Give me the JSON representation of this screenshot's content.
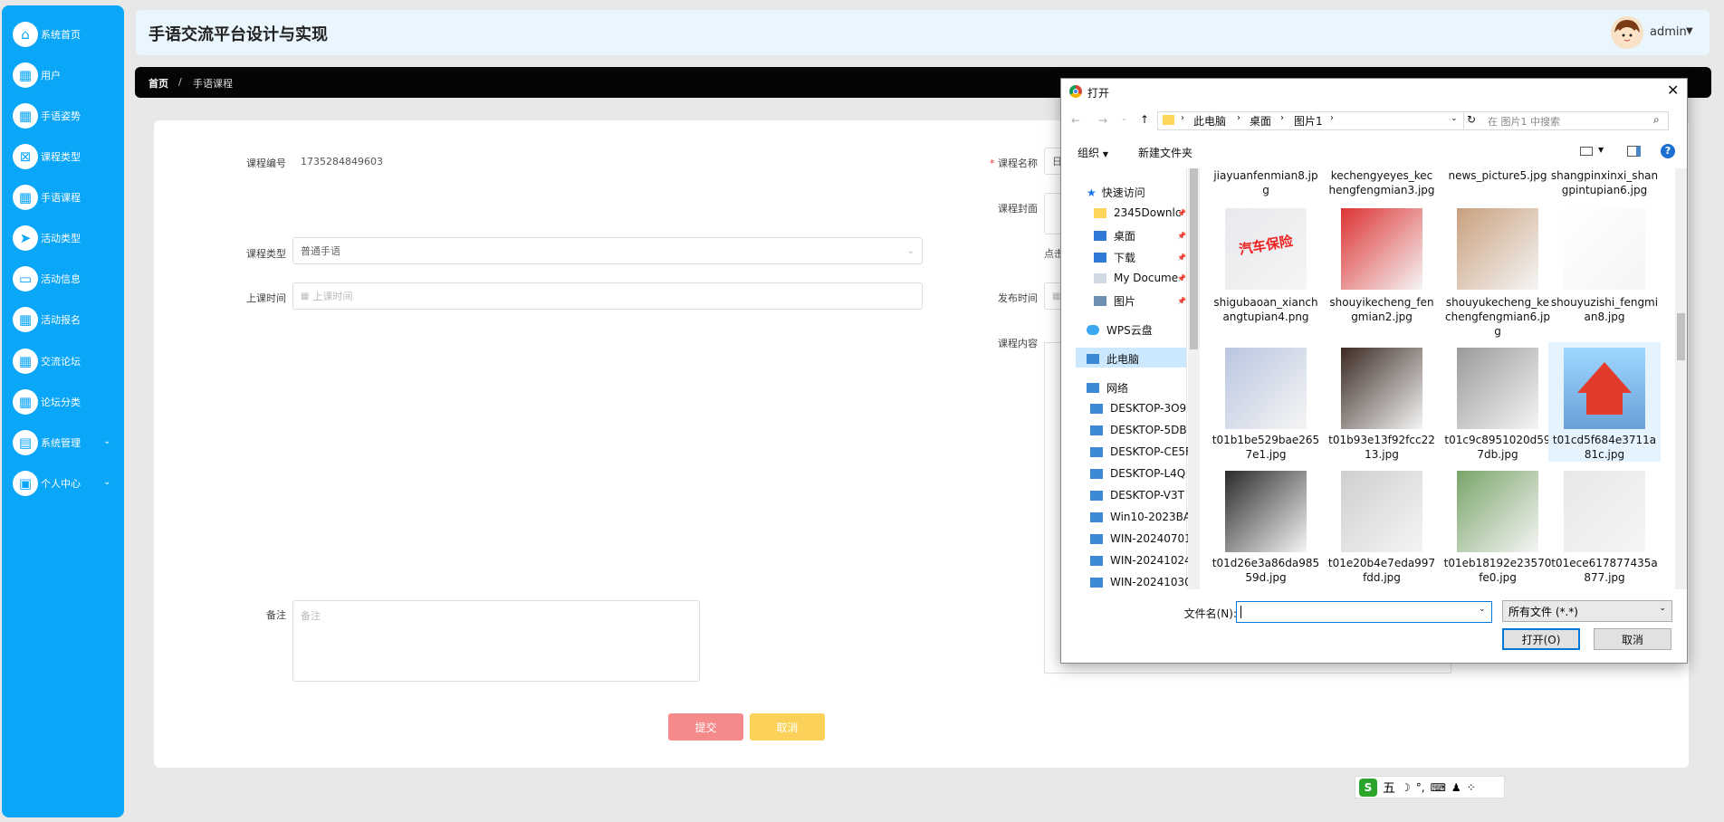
{
  "app": {
    "title": "手语交流平台设计与实现",
    "user": "admin"
  },
  "sidebar": {
    "items": [
      {
        "label": "系统首页",
        "icon": "home-icon",
        "glyph": "⌂"
      },
      {
        "label": "用户",
        "icon": "grid-icon",
        "glyph": "▦"
      },
      {
        "label": "手语姿势",
        "icon": "grid-icon",
        "glyph": "▦"
      },
      {
        "label": "课程类型",
        "icon": "document-icon",
        "glyph": "⊠"
      },
      {
        "label": "手语课程",
        "icon": "grid-icon",
        "glyph": "▦"
      },
      {
        "label": "活动类型",
        "icon": "send-icon",
        "glyph": "➤"
      },
      {
        "label": "活动信息",
        "icon": "chat-icon",
        "glyph": "▭"
      },
      {
        "label": "活动报名",
        "icon": "grid-icon",
        "glyph": "▦"
      },
      {
        "label": "交流论坛",
        "icon": "grid-icon",
        "glyph": "▦"
      },
      {
        "label": "论坛分类",
        "icon": "grid-icon",
        "glyph": "▦"
      },
      {
        "label": "系统管理",
        "icon": "briefcase-icon",
        "glyph": "▤"
      },
      {
        "label": "个人中心",
        "icon": "window-icon",
        "glyph": "▣"
      }
    ]
  },
  "breadcrumb": {
    "home": "首页",
    "sep": "/",
    "current": "手语课程"
  },
  "form": {
    "course_no_label": "课程编号",
    "course_no_value": "1735284849603",
    "course_name_label": "课程名称",
    "course_name_value": "日",
    "cover_label": "课程封面",
    "cover_hint": "点击",
    "type_label": "课程类型",
    "type_value": "普通手语",
    "class_time_label": "上课时间",
    "class_time_placeholder": "上课时间",
    "publish_time_label": "发布时间",
    "content_label": "课程内容",
    "remark_label": "备注",
    "remark_placeholder": "备注",
    "submit_label": "提交",
    "cancel_label": "取消"
  },
  "dialog": {
    "title": "打开",
    "path": [
      "此电脑",
      "桌面",
      "图片1"
    ],
    "search_placeholder": "在 图片1 中搜索",
    "organize": "组织",
    "new_folder": "新建文件夹",
    "nav": {
      "quick_access": "快速访问",
      "items": [
        "2345Downlc",
        "桌面",
        "下载",
        "My Docume",
        "图片"
      ],
      "wps": "WPS云盘",
      "this_pc": "此电脑",
      "network": "网络",
      "computers": [
        "DESKTOP-3O9",
        "DESKTOP-5DB",
        "DESKTOP-CE5F",
        "DESKTOP-L4Q",
        "DESKTOP-V3T",
        "Win10-2023BA",
        "WIN-20240701",
        "WIN-20241024",
        "WIN-20241030"
      ]
    },
    "files_partial": [
      "jiayuanfenmian8.jpg",
      "kechengyeyes_kechengfengmian3.jpg",
      "news_picture5.jpg",
      "shangpinxinxi_shangpintupian6.jpg"
    ],
    "files": [
      [
        "shigubaoan_xianchangtupian4.png",
        "shouyikecheng_fengmian2.jpg",
        "shouyukecheng_kechengfengmian6.jpg",
        "shouyuzishi_fengmian8.jpg"
      ],
      [
        "t01b1be529bae2657e1.jpg",
        "t01b93e13f92fcc2213.jpg",
        "t01c9c8951020d597db.jpg",
        "t01cd5f684e3711a81c.jpg"
      ],
      [
        "t01d26e3a86da98559d.jpg",
        "t01e20b4e7eda997fdd.jpg",
        "t01eb18192e23570fe0.jpg",
        "t01ece617877435a877.jpg"
      ]
    ],
    "filename_label": "文件名(N):",
    "filename_value": "",
    "filter": "所有文件 (*.*)",
    "open_btn": "打开(O)",
    "cancel_btn": "取消"
  },
  "ime": {
    "label": "五"
  },
  "colors": {
    "sidebar": "#0aa6f7",
    "submit": "#f58a8a",
    "cancel": "#fbd159",
    "header_bg": "#eaf6fd"
  }
}
